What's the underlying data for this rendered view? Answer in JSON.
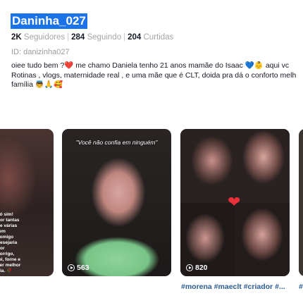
{
  "profile": {
    "username": "Daninha_027",
    "followers_count": "2K",
    "followers_label": "Seguidores",
    "following_count": "284",
    "following_label": "Seguindo",
    "likes_count": "204",
    "likes_label": "Curtidas",
    "id_text": "ID: danizinha027",
    "bio_line1": "oiee tudo bem ?❤️ me chamo Daniela tenho 21 anos mamãe do Isaac 💙👶 aqui vc",
    "bio_line2": "Rotinas , vlogs, maternidade real , e uma mãe que é CLT, doida pra dá o conforto melh",
    "bio_line3": "família 👼🙏🥰"
  },
  "videos": [
    {
      "overlay_text": "só sim! por tantas de várias rem comigo desejaria por sorrigo, ipi, forne e ser melhor dia. 🥀",
      "plays": ""
    },
    {
      "caption": "\"Você não confia em ninguém\"",
      "plays": "563"
    },
    {
      "plays": "820",
      "tags": "#morena #maeclt #criador #..."
    },
    {
      "tags": "#"
    }
  ],
  "colors": {
    "highlight": "#1a73e8",
    "hashtag": "#2b5b92",
    "heart": "#e8303b"
  }
}
